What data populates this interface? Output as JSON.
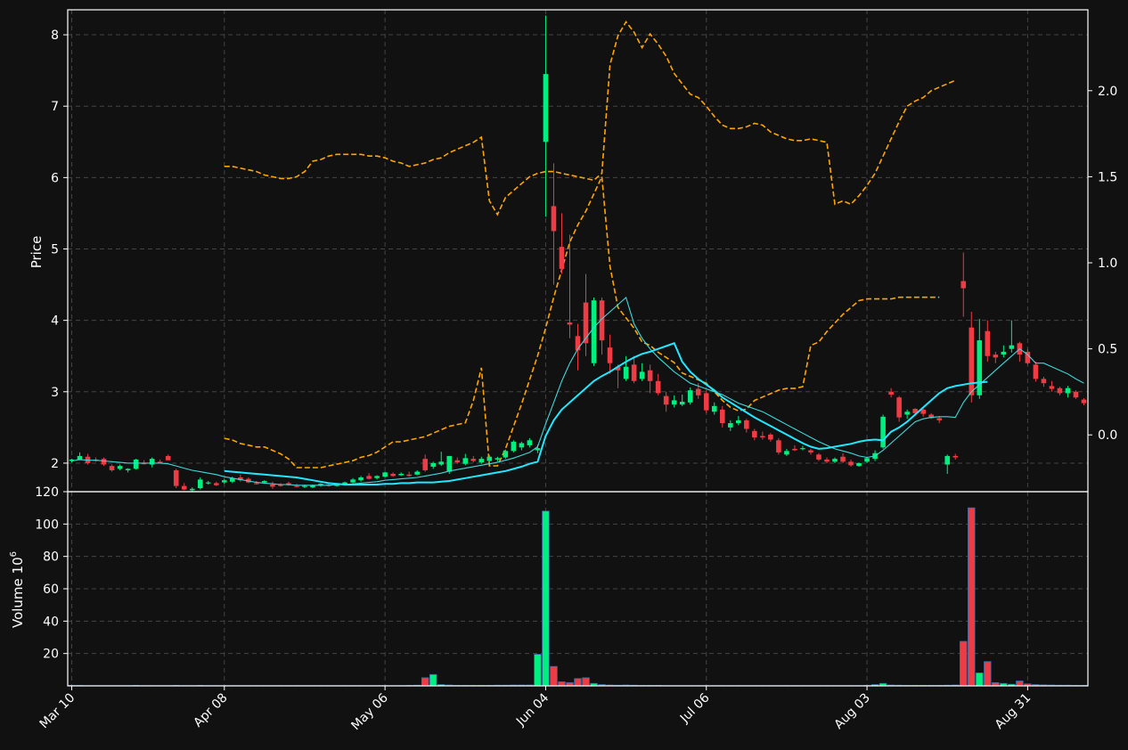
{
  "chart_data": {
    "type": "candlestick",
    "colors": {
      "background": "#111111",
      "up": "#00f080",
      "down": "#ee3b44",
      "ma_short": "#40d8d8",
      "ma_long": "#22e8ff",
      "bollinger": "#ffa500",
      "grid": "#444444",
      "axis": "#ffffff"
    },
    "price_panel": {
      "ylabel": "Price",
      "ylim": [
        1.6,
        8.35
      ],
      "yticks": [
        2,
        3,
        4,
        5,
        6,
        7,
        8
      ],
      "secondary_ylim": [
        -0.33,
        2.47
      ],
      "secondary_yticks": [
        "0.0",
        "0.5",
        "1.0",
        "1.5",
        "2.0"
      ],
      "grid": true
    },
    "volume_panel": {
      "ylabel": "Volume  10",
      "ylabel_exp": "6",
      "ylim": [
        0,
        120
      ],
      "yticks": [
        20,
        40,
        60,
        80,
        100,
        120
      ]
    },
    "x_ticks": [
      {
        "label": "Mar 10",
        "index": 0
      },
      {
        "label": "Apr 08",
        "index": 19
      },
      {
        "label": "May 06",
        "index": 39
      },
      {
        "label": "Jun 04",
        "index": 59
      },
      {
        "label": "Jul 06",
        "index": 79
      },
      {
        "label": "Aug 03",
        "index": 99
      },
      {
        "label": "Aug 31",
        "index": 119
      }
    ],
    "n_bars": 127,
    "candles": [
      [
        2.03,
        2.06,
        2.01,
        2.05
      ],
      [
        2.05,
        2.15,
        2.04,
        2.1
      ],
      [
        2.09,
        2.13,
        1.98,
        2.0
      ],
      [
        2.05,
        2.08,
        2.02,
        2.03
      ],
      [
        2.06,
        2.08,
        1.96,
        1.98
      ],
      [
        1.96,
        1.98,
        1.88,
        1.9
      ],
      [
        1.92,
        1.98,
        1.9,
        1.96
      ],
      [
        1.9,
        1.93,
        1.87,
        1.92
      ],
      [
        1.92,
        2.06,
        1.91,
        2.05
      ],
      [
        2.0,
        2.04,
        1.98,
        1.99
      ],
      [
        1.98,
        2.08,
        1.94,
        2.06
      ],
      [
        2.02,
        2.05,
        2.0,
        2.01
      ],
      [
        2.1,
        2.12,
        2.04,
        2.04
      ],
      [
        1.9,
        1.92,
        1.65,
        1.68
      ],
      [
        1.68,
        1.72,
        1.62,
        1.63
      ],
      [
        1.62,
        1.66,
        1.6,
        1.64
      ],
      [
        1.65,
        1.8,
        1.63,
        1.77
      ],
      [
        1.72,
        1.75,
        1.7,
        1.73
      ],
      [
        1.72,
        1.74,
        1.68,
        1.69
      ],
      [
        1.73,
        1.78,
        1.71,
        1.76
      ],
      [
        1.74,
        1.81,
        1.72,
        1.79
      ],
      [
        1.8,
        1.84,
        1.74,
        1.76
      ],
      [
        1.78,
        1.8,
        1.72,
        1.73
      ],
      [
        1.72,
        1.75,
        1.7,
        1.71
      ],
      [
        1.73,
        1.76,
        1.71,
        1.75
      ],
      [
        1.7,
        1.74,
        1.64,
        1.67
      ],
      [
        1.7,
        1.72,
        1.67,
        1.68
      ],
      [
        1.72,
        1.74,
        1.68,
        1.69
      ],
      [
        1.68,
        1.71,
        1.66,
        1.67
      ],
      [
        1.67,
        1.7,
        1.65,
        1.68
      ],
      [
        1.66,
        1.7,
        1.65,
        1.69
      ],
      [
        1.69,
        1.72,
        1.67,
        1.71
      ],
      [
        1.7,
        1.72,
        1.67,
        1.68
      ],
      [
        1.68,
        1.71,
        1.67,
        1.7
      ],
      [
        1.7,
        1.74,
        1.69,
        1.73
      ],
      [
        1.73,
        1.79,
        1.72,
        1.77
      ],
      [
        1.76,
        1.82,
        1.74,
        1.8
      ],
      [
        1.82,
        1.86,
        1.77,
        1.78
      ],
      [
        1.79,
        1.83,
        1.77,
        1.82
      ],
      [
        1.81,
        1.88,
        1.8,
        1.87
      ],
      [
        1.85,
        1.87,
        1.81,
        1.82
      ],
      [
        1.83,
        1.87,
        1.82,
        1.85
      ],
      [
        1.84,
        1.88,
        1.81,
        1.82
      ],
      [
        1.84,
        1.9,
        1.83,
        1.88
      ],
      [
        2.06,
        2.12,
        1.88,
        1.9
      ],
      [
        1.95,
        2.02,
        1.92,
        2.0
      ],
      [
        1.98,
        2.16,
        1.96,
        2.02
      ],
      [
        1.88,
        2.1,
        1.85,
        2.1
      ],
      [
        2.04,
        2.08,
        1.99,
        2.01
      ],
      [
        1.99,
        2.13,
        1.97,
        2.07
      ],
      [
        2.06,
        2.1,
        2.01,
        2.03
      ],
      [
        2.01,
        2.09,
        1.99,
        2.06
      ],
      [
        2.03,
        2.11,
        2.02,
        2.09
      ],
      [
        2.05,
        2.09,
        2.02,
        2.07
      ],
      [
        2.08,
        2.19,
        2.06,
        2.17
      ],
      [
        2.17,
        2.32,
        2.15,
        2.3
      ],
      [
        2.22,
        2.3,
        2.18,
        2.28
      ],
      [
        2.25,
        2.35,
        2.22,
        2.32
      ],
      [
        2.18,
        2.26,
        2.14,
        2.21
      ],
      [
        6.5,
        8.27,
        5.45,
        7.45
      ],
      [
        5.6,
        6.2,
        4.5,
        5.25
      ],
      [
        5.03,
        5.5,
        4.65,
        4.72
      ],
      [
        3.97,
        5.2,
        3.75,
        3.94
      ],
      [
        3.78,
        3.95,
        3.3,
        3.58
      ],
      [
        4.25,
        4.65,
        3.5,
        3.68
      ],
      [
        3.4,
        4.32,
        3.36,
        4.28
      ],
      [
        4.28,
        4.32,
        3.52,
        3.72
      ],
      [
        3.62,
        3.8,
        3.25,
        3.4
      ],
      [
        3.35,
        3.38,
        3.05,
        3.3
      ],
      [
        3.18,
        3.5,
        3.15,
        3.35
      ],
      [
        3.38,
        3.5,
        3.12,
        3.15
      ],
      [
        3.18,
        3.4,
        3.15,
        3.28
      ],
      [
        3.3,
        3.38,
        2.98,
        3.15
      ],
      [
        3.15,
        3.25,
        2.95,
        2.98
      ],
      [
        2.94,
        3.0,
        2.72,
        2.82
      ],
      [
        2.82,
        2.95,
        2.78,
        2.88
      ],
      [
        2.82,
        2.96,
        2.8,
        2.86
      ],
      [
        2.85,
        3.06,
        2.82,
        3.02
      ],
      [
        3.04,
        3.12,
        2.9,
        2.95
      ],
      [
        2.98,
        3.02,
        2.7,
        2.74
      ],
      [
        2.72,
        2.85,
        2.68,
        2.8
      ],
      [
        2.75,
        2.8,
        2.5,
        2.56
      ],
      [
        2.5,
        2.6,
        2.45,
        2.56
      ],
      [
        2.56,
        2.66,
        2.53,
        2.6
      ],
      [
        2.6,
        2.62,
        2.43,
        2.48
      ],
      [
        2.45,
        2.48,
        2.32,
        2.36
      ],
      [
        2.38,
        2.44,
        2.33,
        2.36
      ],
      [
        2.4,
        2.42,
        2.3,
        2.33
      ],
      [
        2.32,
        2.35,
        2.12,
        2.15
      ],
      [
        2.12,
        2.2,
        2.1,
        2.17
      ],
      [
        2.2,
        2.25,
        2.17,
        2.18
      ],
      [
        2.2,
        2.24,
        2.18,
        2.21
      ],
      [
        2.18,
        2.2,
        2.12,
        2.15
      ],
      [
        2.12,
        2.14,
        2.03,
        2.05
      ],
      [
        2.05,
        2.08,
        2.0,
        2.02
      ],
      [
        2.02,
        2.08,
        2.0,
        2.06
      ],
      [
        2.09,
        2.14,
        2.0,
        2.02
      ],
      [
        2.02,
        2.05,
        1.95,
        1.97
      ],
      [
        1.96,
        2.01,
        1.95,
        2.0
      ],
      [
        2.02,
        2.09,
        2.0,
        2.07
      ],
      [
        2.06,
        2.18,
        2.03,
        2.14
      ],
      [
        2.22,
        2.68,
        2.2,
        2.65
      ],
      [
        3.0,
        3.05,
        2.92,
        2.96
      ],
      [
        2.92,
        2.94,
        2.58,
        2.64
      ],
      [
        2.68,
        2.75,
        2.62,
        2.72
      ],
      [
        2.76,
        2.77,
        2.66,
        2.7
      ],
      [
        2.75,
        2.77,
        2.65,
        2.69
      ],
      [
        2.68,
        2.7,
        2.62,
        2.63
      ],
      [
        2.63,
        2.66,
        2.56,
        2.6
      ],
      [
        1.98,
        2.12,
        1.85,
        2.1
      ],
      [
        2.1,
        2.13,
        2.05,
        2.08
      ],
      [
        4.55,
        4.95,
        4.05,
        4.45
      ],
      [
        3.9,
        4.12,
        2.85,
        2.95
      ],
      [
        2.95,
        4.02,
        2.9,
        3.72
      ],
      [
        3.85,
        4.0,
        3.42,
        3.5
      ],
      [
        3.52,
        3.56,
        3.4,
        3.48
      ],
      [
        3.52,
        3.65,
        3.48,
        3.56
      ],
      [
        3.6,
        4.0,
        3.55,
        3.65
      ],
      [
        3.68,
        3.7,
        3.42,
        3.52
      ],
      [
        3.56,
        3.6,
        3.38,
        3.4
      ],
      [
        3.38,
        3.42,
        3.14,
        3.18
      ],
      [
        3.18,
        3.21,
        3.07,
        3.12
      ],
      [
        3.08,
        3.15,
        3.0,
        3.04
      ],
      [
        3.05,
        3.07,
        2.95,
        2.98
      ],
      [
        2.98,
        3.08,
        2.92,
        3.05
      ],
      [
        3.0,
        3.02,
        2.9,
        2.92
      ],
      [
        2.89,
        2.91,
        2.81,
        2.84
      ]
    ],
    "volume": [
      0.3,
      0.3,
      0.2,
      0.2,
      0.2,
      0.2,
      0.2,
      0.2,
      0.3,
      0.2,
      0.2,
      0.2,
      0.2,
      0.3,
      0.2,
      0.2,
      0.3,
      0.2,
      0.2,
      0.2,
      0.2,
      0.2,
      0.2,
      0.2,
      0.2,
      0.2,
      0.2,
      0.2,
      0.2,
      0.2,
      0.2,
      0.2,
      0.2,
      0.2,
      0.2,
      0.2,
      0.2,
      0.2,
      0.2,
      0.2,
      0.2,
      0.2,
      0.3,
      0.4,
      5.0,
      7.0,
      0.8,
      0.5,
      0.3,
      0.3,
      0.3,
      0.3,
      0.3,
      0.4,
      0.4,
      0.5,
      0.5,
      0.5,
      19.5,
      108.0,
      12.0,
      2.5,
      2.0,
      4.5,
      5.0,
      1.5,
      0.8,
      0.5,
      0.4,
      0.5,
      0.4,
      0.3,
      0.3,
      0.3,
      0.2,
      0.2,
      0.2,
      0.2,
      0.2,
      0.2,
      0.2,
      0.2,
      0.2,
      0.2,
      0.2,
      0.2,
      0.2,
      0.2,
      0.2,
      0.2,
      0.2,
      0.2,
      0.2,
      0.2,
      0.2,
      0.2,
      0.2,
      0.2,
      0.2,
      0.3,
      0.8,
      1.5,
      0.5,
      0.4,
      0.3,
      0.3,
      0.3,
      0.3,
      0.3,
      0.4,
      0.5,
      27.5,
      110.0,
      8.0,
      15.0,
      2.0,
      1.5,
      1.0,
      3.0,
      1.2,
      0.8,
      0.6,
      0.5,
      0.4,
      0.4,
      0.3,
      0.3
    ],
    "ma_short": [
      2.03,
      2.05,
      2.04,
      2.04,
      2.03,
      2.02,
      2.01,
      2.0,
      2.0,
      2.0,
      2.0,
      2.0,
      1.99,
      1.96,
      1.93,
      1.9,
      1.88,
      1.86,
      1.84,
      1.81,
      1.79,
      1.77,
      1.75,
      1.73,
      1.72,
      1.71,
      1.7,
      1.7,
      1.69,
      1.69,
      1.69,
      1.69,
      1.69,
      1.7,
      1.7,
      1.71,
      1.72,
      1.73,
      1.74,
      1.76,
      1.77,
      1.78,
      1.79,
      1.8,
      1.82,
      1.84,
      1.86,
      1.89,
      1.91,
      1.93,
      1.95,
      1.97,
      1.99,
      2.01,
      2.04,
      2.07,
      2.11,
      2.15,
      2.23,
      2.55,
      2.85,
      3.15,
      3.4,
      3.6,
      3.75,
      3.9,
      4.02,
      4.12,
      4.22,
      4.32,
      3.95,
      3.75,
      3.6,
      3.48,
      3.38,
      3.28,
      3.2,
      3.12,
      3.08,
      3.04,
      3.0,
      2.96,
      2.9,
      2.84,
      2.8,
      2.76,
      2.72,
      2.66,
      2.6,
      2.54,
      2.48,
      2.42,
      2.36,
      2.3,
      2.25,
      2.2,
      2.17,
      2.14,
      2.1,
      2.08,
      2.1,
      2.18,
      2.28,
      2.38,
      2.48,
      2.58,
      2.62,
      2.64,
      2.65,
      2.65,
      2.64,
      2.85,
      3.0,
      3.1,
      3.2,
      3.3,
      3.4,
      3.5,
      3.6,
      3.52,
      3.4,
      3.4,
      3.35,
      3.3,
      3.25,
      3.18,
      3.12
    ],
    "ma_long_start": 19,
    "ma_long": [
      1.89,
      1.88,
      1.87,
      1.86,
      1.85,
      1.84,
      1.83,
      1.82,
      1.81,
      1.8,
      1.78,
      1.76,
      1.74,
      1.72,
      1.71,
      1.7,
      1.7,
      1.7,
      1.7,
      1.7,
      1.71,
      1.71,
      1.72,
      1.72,
      1.73,
      1.73,
      1.73,
      1.74,
      1.75,
      1.77,
      1.79,
      1.81,
      1.83,
      1.85,
      1.87,
      1.89,
      1.92,
      1.95,
      1.99,
      2.02,
      2.38,
      2.6,
      2.75,
      2.85,
      2.95,
      3.05,
      3.15,
      3.22,
      3.28,
      3.35,
      3.42,
      3.48,
      3.53,
      3.56,
      3.6,
      3.64,
      3.68,
      3.42,
      3.28,
      3.18,
      3.1,
      3.02,
      2.92,
      2.85,
      2.78,
      2.71,
      2.64,
      2.58,
      2.52,
      2.46,
      2.4,
      2.34,
      2.28,
      2.23,
      2.2,
      2.21,
      2.23,
      2.25,
      2.27,
      2.3,
      2.32,
      2.33,
      2.32,
      2.44,
      2.5,
      2.58,
      2.68,
      2.78,
      2.88,
      2.98,
      3.05,
      3.08,
      3.1,
      3.12,
      3.13,
      3.14
    ],
    "bollinger_start": 19,
    "boll_upper": [
      1.56,
      1.56,
      1.55,
      1.54,
      1.53,
      1.51,
      1.5,
      1.49,
      1.49,
      1.5,
      1.53,
      1.59,
      1.6,
      1.62,
      1.63,
      1.63,
      1.63,
      1.63,
      1.62,
      1.62,
      1.61,
      1.59,
      1.58,
      1.56,
      1.57,
      1.58,
      1.6,
      1.61,
      1.64,
      1.66,
      1.68,
      1.7,
      1.73,
      1.36,
      1.28,
      1.38,
      1.42,
      1.46,
      1.5,
      1.52,
      1.53,
      1.53,
      1.52,
      1.51,
      1.5,
      1.49,
      1.48,
      1.52,
      2.15,
      2.32,
      2.4,
      2.34,
      2.25,
      2.33,
      2.27,
      2.2,
      2.1,
      2.04,
      1.98,
      1.96,
      1.91,
      1.85,
      1.8,
      1.78,
      1.78,
      1.79,
      1.81,
      1.8,
      1.76,
      1.74,
      1.72,
      1.71,
      1.71,
      1.72,
      1.71,
      1.7,
      1.34,
      1.36,
      1.34,
      1.39,
      1.45,
      1.52,
      1.62,
      1.72,
      1.82,
      1.91,
      1.94,
      1.96,
      2.0,
      2.02,
      2.04,
      2.06
    ],
    "boll_lower": [
      -0.02,
      -0.03,
      -0.05,
      -0.06,
      -0.07,
      -0.07,
      -0.09,
      -0.11,
      -0.14,
      -0.19,
      -0.19,
      -0.19,
      -0.19,
      -0.18,
      -0.17,
      -0.16,
      -0.15,
      -0.13,
      -0.12,
      -0.1,
      -0.07,
      -0.04,
      -0.04,
      -0.03,
      -0.02,
      -0.01,
      0.01,
      0.03,
      0.05,
      0.06,
      0.07,
      0.2,
      0.39,
      -0.18,
      -0.18,
      -0.08,
      0.05,
      0.18,
      0.32,
      0.46,
      0.62,
      0.8,
      0.96,
      1.12,
      1.22,
      1.3,
      1.4,
      1.5,
      0.98,
      0.74,
      0.68,
      0.62,
      0.54,
      0.52,
      0.48,
      0.45,
      0.42,
      0.36,
      0.34,
      0.32,
      0.3,
      0.25,
      0.2,
      0.16,
      0.14,
      0.15,
      0.2,
      0.22,
      0.24,
      0.26,
      0.27,
      0.27,
      0.28,
      0.52,
      0.54,
      0.6,
      0.65,
      0.7,
      0.74,
      0.78,
      0.79,
      0.79,
      0.79,
      0.79,
      0.8,
      0.8,
      0.8,
      0.8,
      0.8,
      0.8
    ]
  }
}
